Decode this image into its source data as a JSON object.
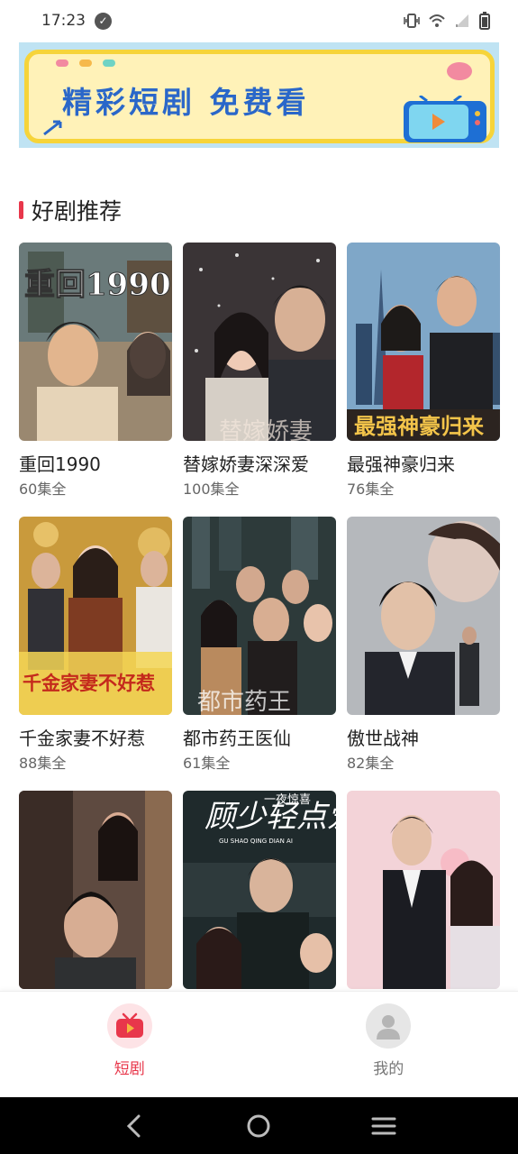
{
  "status_bar": {
    "time": "17:23",
    "icons": [
      "vibrate-icon",
      "wifi-icon",
      "signal-icon",
      "battery-icon"
    ]
  },
  "banner": {
    "text": "精彩短剧 免费看",
    "colors": {
      "background": "#bfe3f3",
      "frame": "#f6d43a",
      "text": "#2a67c9"
    }
  },
  "section": {
    "title": "好剧推荐",
    "accent": "#e8374b"
  },
  "dramas": [
    {
      "title": "重回1990",
      "episodes": "60集全"
    },
    {
      "title": "替嫁娇妻深深爱",
      "episodes": "100集全"
    },
    {
      "title": "最强神豪归来",
      "episodes": "76集全"
    },
    {
      "title": "千金家妻不好惹",
      "episodes": "88集全"
    },
    {
      "title": "都市药王医仙",
      "episodes": "61集全"
    },
    {
      "title": "傲世战神",
      "episodes": "82集全"
    },
    {
      "title": "",
      "episodes": ""
    },
    {
      "title": "",
      "episodes": ""
    },
    {
      "title": "",
      "episodes": ""
    }
  ],
  "poster_text": {
    "p1": "重回1990",
    "p2": "替嫁娇妻",
    "p3": "最强神豪归来",
    "p4": "千金家妻不好惹",
    "p5": "都市药王",
    "p8_title": "顾少轻点爱",
    "p8_sub": "一夜惊喜",
    "p8_pinyin": "GU SHAO QING DIAN AI"
  },
  "bottom_nav": {
    "items": [
      {
        "label": "短剧",
        "icon": "tv-play-icon",
        "active": true
      },
      {
        "label": "我的",
        "icon": "user-icon",
        "active": false
      }
    ],
    "active_color": "#e8374b",
    "inactive_color": "#777777"
  },
  "system_nav": {
    "icons": [
      "back-icon",
      "home-icon",
      "recents-icon"
    ]
  }
}
